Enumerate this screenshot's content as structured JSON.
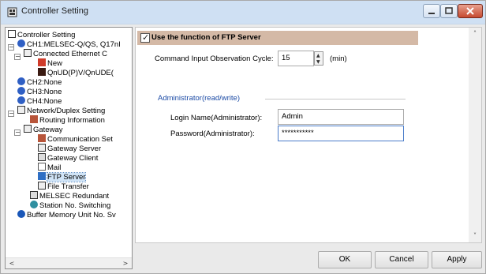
{
  "window": {
    "title": "Controller Setting"
  },
  "tree": {
    "items": [
      {
        "label": "Controller Setting",
        "icon": "controller-icon"
      },
      {
        "label": "CH1:MELSEC-Q/QS, Q17nI",
        "icon": "channel-icon"
      },
      {
        "label": "Connected Ethernet C",
        "icon": "network-icon"
      },
      {
        "label": "New",
        "icon": "new-device-icon"
      },
      {
        "label": "QnUD(P)V/QnUDE(",
        "icon": "plc-icon"
      },
      {
        "label": "CH2:None",
        "icon": "channel-icon"
      },
      {
        "label": "CH3:None",
        "icon": "channel-icon"
      },
      {
        "label": "CH4:None",
        "icon": "channel-icon"
      },
      {
        "label": "Network/Duplex Setting",
        "icon": "network-icon"
      },
      {
        "label": "Routing Information",
        "icon": "routing-icon"
      },
      {
        "label": "Gateway",
        "icon": "gateway-icon"
      },
      {
        "label": "Communication Set",
        "icon": "communication-icon"
      },
      {
        "label": "Gateway Server",
        "icon": "server-icon"
      },
      {
        "label": "Gateway Client",
        "icon": "client-icon"
      },
      {
        "label": "Mail",
        "icon": "mail-icon"
      },
      {
        "label": "FTP Server",
        "icon": "ftp-icon"
      },
      {
        "label": "File Transfer",
        "icon": "file-transfer-icon"
      },
      {
        "label": "MELSEC Redundant",
        "icon": "redundant-icon"
      },
      {
        "label": "Station No. Switching",
        "icon": "switching-icon"
      },
      {
        "label": "Buffer Memory Unit No. Sv",
        "icon": "buffer-memory-icon"
      }
    ],
    "selected": "FTP Server"
  },
  "ftp": {
    "use_function_label": "Use the function of FTP Server",
    "use_function_checked": true,
    "cycle_label": "Command Input Observation Cycle:",
    "cycle_value": "15",
    "cycle_unit": "(min)",
    "admin_section": "Administrator(read/write)",
    "login_label": "Login Name(Administrator):",
    "login_value": "Admin",
    "password_label": "Password(Administrator):",
    "password_value": "***********"
  },
  "buttons": {
    "ok": "OK",
    "cancel": "Cancel",
    "apply": "Apply"
  },
  "colors": {
    "title_bar": "#cfe0f3",
    "header_band": "#d4b9a6",
    "section_title": "#1b4aa5",
    "selection": "#d0e4f7"
  }
}
